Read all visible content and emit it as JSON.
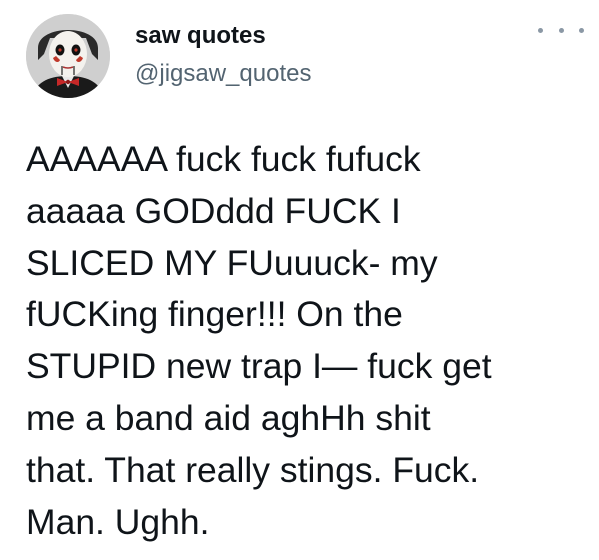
{
  "user": {
    "display_name": "saw quotes",
    "handle": "@jigsaw_quotes",
    "avatar_icon": "jigsaw-puppet-avatar"
  },
  "menu": {
    "icon": "more-options-icon"
  },
  "tweet": {
    "text": "AAAAAA fuck fuck fufuck\naaaaa GODddd FUCK I\nSLICED MY FUuuuck- my\nfUCKing finger!!! On the\nSTUPID new trap I— fuck get\nme a band aid aghHh shit\nthat. That really stings. Fuck.\nMan. Ughh."
  },
  "colors": {
    "text": "#0f1419",
    "secondary": "#536471",
    "background": "#ffffff"
  }
}
